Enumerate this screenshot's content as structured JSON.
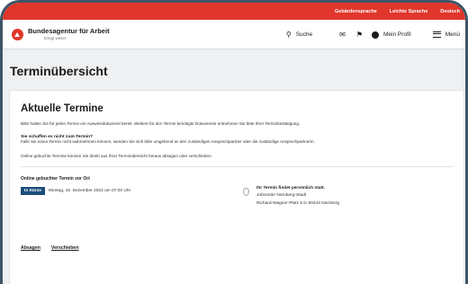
{
  "topbar": {
    "links": [
      "Gebärdensprache",
      "Leichte Sprache",
      "Deutsch"
    ]
  },
  "header": {
    "logo_title": "Bundesagentur für Arbeit",
    "logo_subtitle": "bringt weiter",
    "search_label": "Suche",
    "profile_label": "Mein Profil",
    "menu_label": "Menü"
  },
  "page": {
    "title": "Terminübersicht"
  },
  "card": {
    "title": "Aktuelle Termine",
    "intro": "Bitte halten Sie für jeden Termin ein Ausweisdokument bereit. Weitere für den Termin benötigte Dokumente entnehmen Sie bitte Ihrer Terminbestätigung.",
    "question": "Sie schaffen es nicht zum Termin?",
    "question_text": "Falls Sie einen Termin nicht wahrnehmen können, wenden Sie sich bitte umgehend an den zuständigen Ansprechpartner oder die zuständige Ansprechpartnerin.",
    "online_note": "Online gebuchte Termine können Sie direkt aus Ihrer Terminübersicht heraus absagen oder verschieben."
  },
  "appointment": {
    "label": "Online gebuchter Termin vor Ort",
    "badge": "In Kürze",
    "date": "Montag, 19. Dezember 2022 um 07:00 Uhr",
    "location_head": "Ihr Termin findet persönlich statt.",
    "location_office": "Jobcenter Nürnberg-Stadt",
    "location_address": "Richard-Wagner-Platz 5 in 90443 Nürnberg"
  },
  "actions": {
    "cancel": "Absagen",
    "reschedule": "Verschieben"
  },
  "colors": {
    "brand_red": "#e0362b",
    "badge_blue": "#1d4e7a"
  }
}
